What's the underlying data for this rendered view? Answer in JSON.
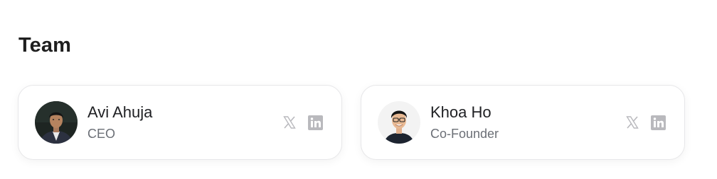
{
  "section": {
    "title": "Team"
  },
  "members": [
    {
      "name": "Avi Ahuja",
      "role": "CEO",
      "avatar_icon": "person-photo-icon",
      "socials": [
        {
          "icon": "x-twitter-icon"
        },
        {
          "icon": "linkedin-icon"
        }
      ]
    },
    {
      "name": "Khoa Ho",
      "role": "Co-Founder",
      "avatar_icon": "person-photo-icon",
      "socials": [
        {
          "icon": "x-twitter-icon"
        },
        {
          "icon": "linkedin-icon"
        }
      ]
    }
  ],
  "colors": {
    "icon_gray": "#b9b9bd",
    "card_border": "#e7e7e9",
    "role_text": "#6b6f76"
  }
}
